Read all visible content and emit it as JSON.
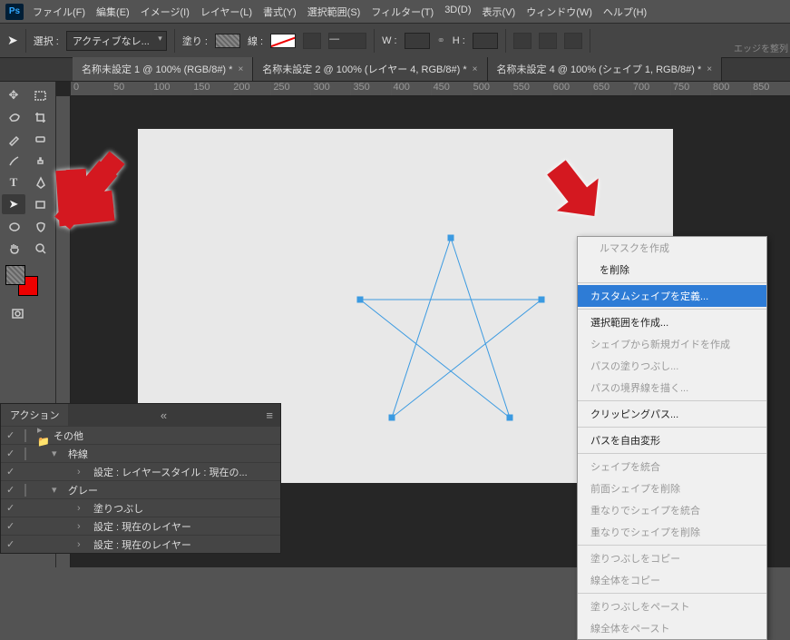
{
  "app": "Ps",
  "menu": [
    "ファイル(F)",
    "編集(E)",
    "イメージ(I)",
    "レイヤー(L)",
    "書式(Y)",
    "選択範囲(S)",
    "フィルター(T)",
    "3D(D)",
    "表示(V)",
    "ウィンドウ(W)",
    "ヘルプ(H)"
  ],
  "options": {
    "select_label": "選択 :",
    "select_value": "アクティブなレ...",
    "fill_label": "塗り :",
    "stroke_label": "線 :",
    "w_label": "W :",
    "h_label": "H :",
    "edge_label": "エッジを整列"
  },
  "tabs": [
    "名称未設定 1 @ 100% (RGB/8#) *",
    "名称未設定 2 @ 100% (レイヤー 4, RGB/8#) *",
    "名称未設定 4 @ 100% (シェイプ 1, RGB/8#) *"
  ],
  "ruler_ticks": [
    "0",
    "50",
    "100",
    "150",
    "200",
    "250",
    "300",
    "350",
    "400",
    "450",
    "500",
    "550",
    "600",
    "650",
    "700",
    "750",
    "800",
    "850"
  ],
  "panel": {
    "title": "アクション",
    "rows": [
      {
        "indent": 0,
        "icon": "folder",
        "label": "その他",
        "chk": true,
        "box": true
      },
      {
        "indent": 1,
        "icon": "caret",
        "label": "枠線",
        "chk": true,
        "box": true
      },
      {
        "indent": 2,
        "icon": "sub",
        "label": "設定 : レイヤースタイル :  現在の...",
        "chk": true,
        "box": false
      },
      {
        "indent": 1,
        "icon": "caret",
        "label": "グレー",
        "chk": true,
        "box": true
      },
      {
        "indent": 2,
        "icon": "sub",
        "label": "塗りつぶし",
        "chk": true,
        "box": false
      },
      {
        "indent": 2,
        "icon": "sub",
        "label": "設定 : 現在のレイヤー",
        "chk": true,
        "box": false
      },
      {
        "indent": 2,
        "icon": "sub",
        "label": "設定 : 現在のレイヤー",
        "chk": true,
        "box": false
      }
    ]
  },
  "context_menu": [
    {
      "label": "ルマスクを作成",
      "disabled": true,
      "partial_left": true
    },
    {
      "label": "を削除",
      "partial_left": true
    },
    {
      "sep": true
    },
    {
      "label": "カスタムシェイプを定義...",
      "highlight": true
    },
    {
      "sep": true
    },
    {
      "label": "選択範囲を作成..."
    },
    {
      "label": "シェイプから新規ガイドを作成",
      "disabled": true
    },
    {
      "label": "パスの塗りつぶし...",
      "disabled": true
    },
    {
      "label": "パスの境界線を描く...",
      "disabled": true
    },
    {
      "sep": true
    },
    {
      "label": "クリッピングパス..."
    },
    {
      "sep": true
    },
    {
      "label": "パスを自由変形"
    },
    {
      "sep": true
    },
    {
      "label": "シェイプを統合",
      "disabled": true
    },
    {
      "label": "前面シェイプを削除",
      "disabled": true
    },
    {
      "label": "重なりでシェイプを統合",
      "disabled": true
    },
    {
      "label": "重なりでシェイプを削除",
      "disabled": true
    },
    {
      "sep": true
    },
    {
      "label": "塗りつぶしをコピー",
      "disabled": true
    },
    {
      "label": "線全体をコピー",
      "disabled": true
    },
    {
      "sep": true
    },
    {
      "label": "塗りつぶしをペースト",
      "disabled": true
    },
    {
      "label": "線全体をペースト",
      "disabled": true
    }
  ]
}
